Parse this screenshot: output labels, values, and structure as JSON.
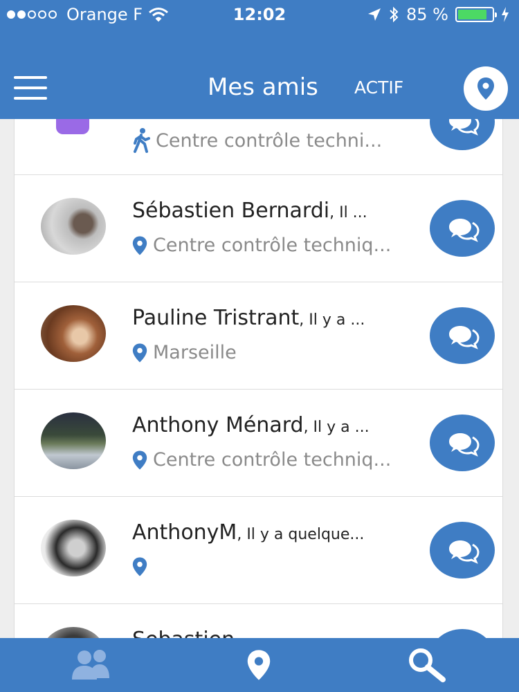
{
  "status_bar": {
    "carrier": "Orange F",
    "time": "12:02",
    "battery": "85 %",
    "battery_level": 0.85
  },
  "header": {
    "title": "Mes amis",
    "actif_label": "ACTIF",
    "menu_icon": "hamburger-menu-icon",
    "location_icon": "location-pin-icon"
  },
  "friends": [
    {
      "name": "",
      "since": "",
      "location": "Centre contrôle techni...",
      "location_icon": "walking-icon",
      "avatar": "purple-avatar"
    },
    {
      "name": "Sébastien Bernardi",
      "since": ", Il ...",
      "location": "Centre contrôle techniq...",
      "location_icon": "location-pin-icon",
      "avatar": "photo-avatar"
    },
    {
      "name": "Pauline Tristrant",
      "since": ", Il y a ...",
      "location": "Marseille",
      "location_icon": "location-pin-icon",
      "avatar": "photo-avatar"
    },
    {
      "name": "Anthony Ménard",
      "since": ", Il y a ...",
      "location": "Centre contrôle techniq...",
      "location_icon": "location-pin-icon",
      "avatar": "photo-avatar"
    },
    {
      "name": "AnthonyM",
      "since": ", Il y a quelque...",
      "location": "",
      "location_icon": "location-pin-icon",
      "avatar": "photo-avatar"
    },
    {
      "name": "Sebastien",
      "since": "",
      "location": "",
      "location_icon": "location-pin-icon",
      "avatar": "photo-avatar"
    }
  ],
  "tab_bar": {
    "tabs": [
      "friends-icon",
      "location-pin-icon",
      "search-icon"
    ]
  },
  "colors": {
    "primary": "#3f7dc4",
    "background": "#eeeeee",
    "muted_text": "#8a8a8a",
    "battery": "#4cd964"
  }
}
